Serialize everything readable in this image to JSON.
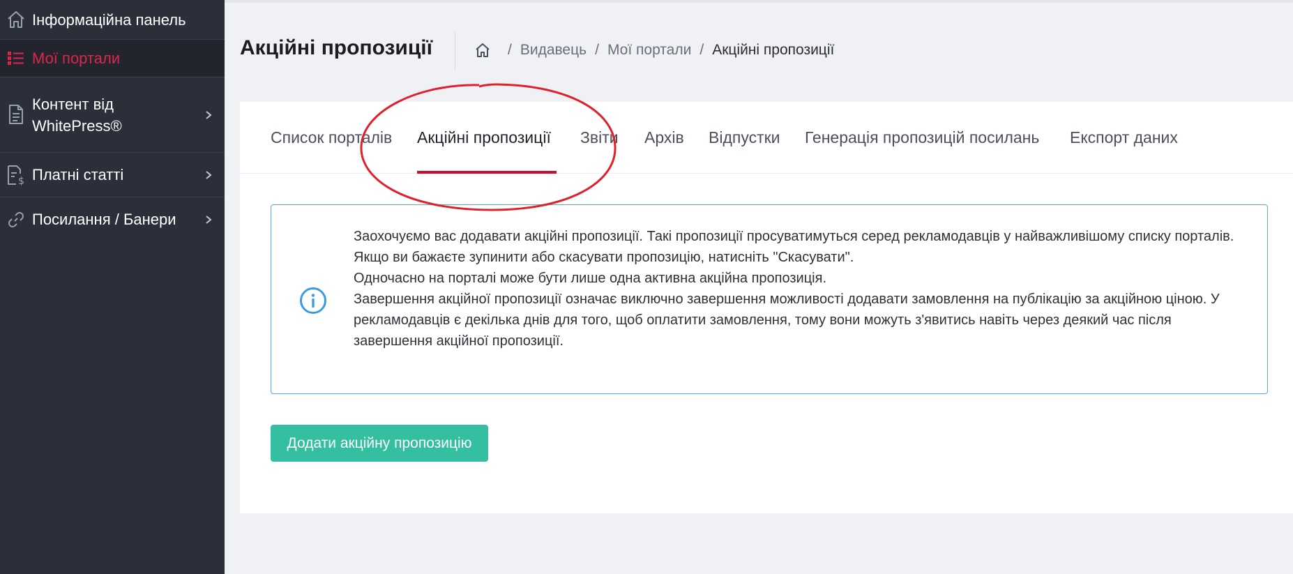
{
  "sidebar": {
    "items": [
      {
        "label": "Інформаційна панель",
        "icon": "home-icon"
      },
      {
        "label": "Мої портали",
        "icon": "list-icon"
      },
      {
        "label": "Контент від WhitePress®",
        "label_line1": "Контент від",
        "label_line2": "WhitePress®",
        "icon": "document-icon"
      },
      {
        "label": "Платні статті",
        "icon": "paid-articles-icon"
      },
      {
        "label": "Посилання / Банери",
        "icon": "link-icon"
      }
    ]
  },
  "header": {
    "title": "Акційні пропозиції",
    "breadcrumb": [
      "Видавець",
      "Мої портали",
      "Акційні пропозиції"
    ]
  },
  "tabs": [
    {
      "label": "Список порталів"
    },
    {
      "label": "Акційні пропозиції"
    },
    {
      "label": "Звіти"
    },
    {
      "label": "Архів"
    },
    {
      "label": "Відпустки"
    },
    {
      "label": "Генерація пропозицій посилань"
    },
    {
      "label": "Експорт даних"
    }
  ],
  "info": {
    "lines": [
      "Заохочуємо вас додавати акційні пропозиції. Такі пропозиції просуватимуться серед рекламодавців у найважливішому списку порталів.",
      "Якщо ви бажаєте зупинити або скасувати пропозицію, натисніть \"Скасувати\".",
      "Одночасно на порталі може бути лише одна активна акційна пропозиція.",
      "Завершення акційної пропозиції означає виключно завершення можливості додавати замовлення на публікацію за акційною ціною. У рекламодавців є декілька днів для того, щоб оплатити замовлення, тому вони можуть з'явитись навіть через деякий час після завершення акційної пропозиції."
    ]
  },
  "actions": {
    "add_label": "Додати акційну пропозицію"
  },
  "colors": {
    "sidebar_bg": "#2b2f3a",
    "active_accent": "#e0254a",
    "tab_underline": "#c8102e",
    "info_border": "#56a6e8",
    "button_bg": "#34bfa0",
    "annotation": "#e0202a"
  }
}
